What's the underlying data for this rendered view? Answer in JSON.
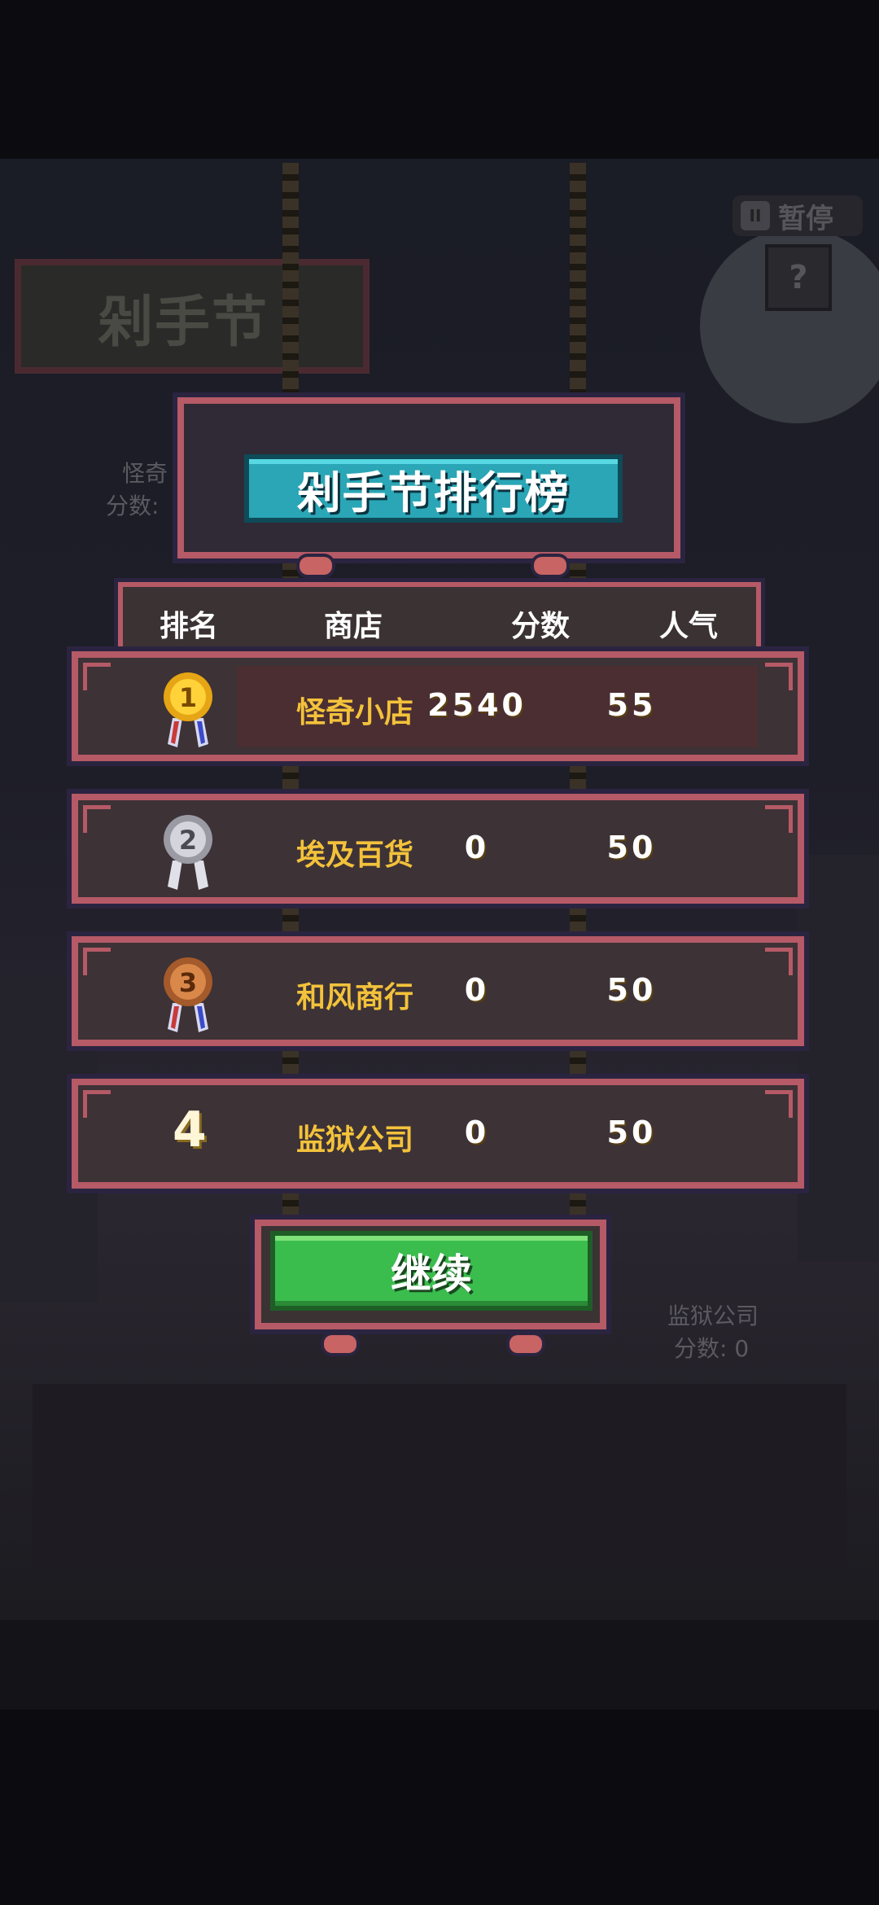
{
  "background": {
    "festival_sign": "剁手节",
    "pause_label": "暂停",
    "help_label": "?",
    "bg_store_top_left": [
      "怪奇",
      "分数:"
    ],
    "bg_store_right": [
      "监狱公司",
      "分数: 0"
    ]
  },
  "leaderboard": {
    "title": "剁手节排行榜",
    "headers": {
      "rank": "排名",
      "shop": "商店",
      "score": "分数",
      "popularity": "人气"
    },
    "rows": [
      {
        "rank": "1",
        "medal": "gold-medal-icon",
        "shop": "怪奇小店",
        "score": "2540",
        "popularity": "55"
      },
      {
        "rank": "2",
        "medal": "silver-medal-icon",
        "shop": "埃及百货",
        "score": "0",
        "popularity": "50"
      },
      {
        "rank": "3",
        "medal": "bronze-medal-icon",
        "shop": "和风商行",
        "score": "0",
        "popularity": "50"
      },
      {
        "rank": "4",
        "medal": "",
        "shop": "监狱公司",
        "score": "0",
        "popularity": "50"
      }
    ]
  },
  "actions": {
    "continue_label": "继续"
  },
  "colors": {
    "frame": "#b55a66",
    "title_bg": "#2aa6b6",
    "shop_text": "#f3c23b",
    "button_green": "#3bbd4e"
  }
}
